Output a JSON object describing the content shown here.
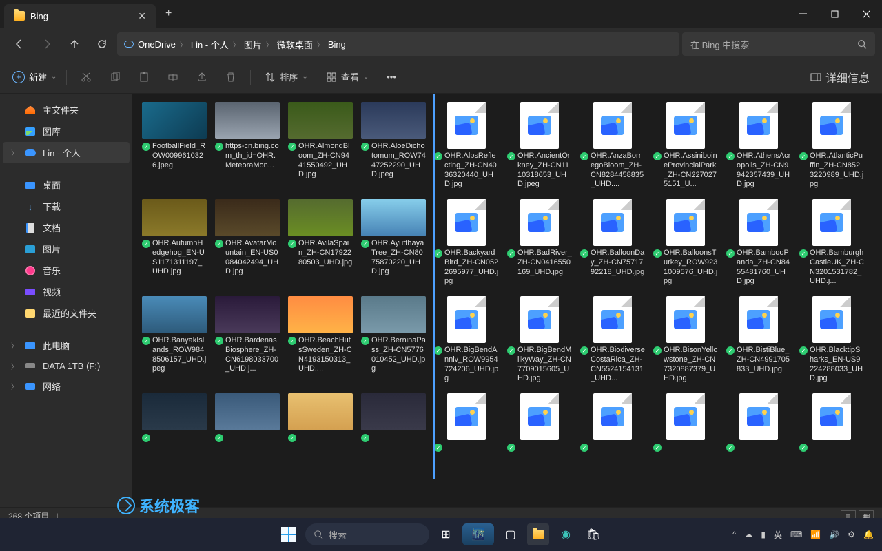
{
  "tab": {
    "title": "Bing"
  },
  "breadcrumbs": [
    "OneDrive",
    "Lin - 个人",
    "图片",
    "微软桌面",
    "Bing"
  ],
  "search": {
    "placeholder": "在 Bing 中搜索"
  },
  "toolbar": {
    "new": "新建",
    "sort": "排序",
    "view": "查看",
    "details": "详细信息"
  },
  "sidebar": {
    "home": "主文件夹",
    "gallery": "图库",
    "onedrive": "Lin - 个人",
    "desktop": "桌面",
    "downloads": "下载",
    "documents": "文档",
    "pictures": "图片",
    "music": "音乐",
    "videos": "视频",
    "recent": "最近的文件夹",
    "thispc": "此电脑",
    "drive": "DATA 1TB (F:)",
    "network": "网络"
  },
  "files": [
    {
      "name": "FootballField_ROW0099610326.jpeg",
      "t": "t0",
      "img": true
    },
    {
      "name": "https-cn.bing.com_th_id=OHR.MeteoraMon...",
      "t": "t1",
      "img": true
    },
    {
      "name": "OHR.AlmondBloom_ZH-CN9441550492_UHD.jpg",
      "t": "t2",
      "img": true
    },
    {
      "name": "OHR.AloeDichotomum_ROW7447252290_UHD.jpeg",
      "t": "t3",
      "img": true
    },
    {
      "name": "OHR.AlpsReflecting_ZH-CN4036320440_UHD.jpg",
      "t": "",
      "img": false
    },
    {
      "name": "OHR.AncientOrkney_ZH-CN1110318653_UHD.jpeg",
      "t": "",
      "img": false
    },
    {
      "name": "OHR.AnzaBorregoBloom_ZH-CN8284458835_UHD....",
      "t": "",
      "img": false
    },
    {
      "name": "OHR.AssiniboineProvincialPark_ZH-CN2270275151_U...",
      "t": "",
      "img": false
    },
    {
      "name": "OHR.AthensAcropolis_ZH-CN9942357439_UHD.jpg",
      "t": "",
      "img": false
    },
    {
      "name": "OHR.AtlanticPuffin_ZH-CN8523220989_UHD.jpg",
      "t": "",
      "img": false
    },
    {
      "name": "OHR.AutumnHedgehog_EN-US1171311197_UHD.jpg",
      "t": "t4",
      "img": true
    },
    {
      "name": "OHR.AvatarMountain_EN-US0084042494_UHD.jpg",
      "t": "t5",
      "img": true
    },
    {
      "name": "OHR.AvilaSpain_ZH-CN1792280503_UHD.jpg",
      "t": "t6",
      "img": true
    },
    {
      "name": "OHR.AyutthayaTree_ZH-CN8075870220_UHD.jpg",
      "t": "t7",
      "img": true
    },
    {
      "name": "OHR.BackyardBird_ZH-CN0522695977_UHD.jpg",
      "t": "",
      "img": false
    },
    {
      "name": "OHR.BadRiver_ZH-CN0416550169_UHD.jpg",
      "t": "",
      "img": false
    },
    {
      "name": "OHR.BalloonDay_ZH-CN7571792218_UHD.jpg",
      "t": "",
      "img": false
    },
    {
      "name": "OHR.BalloonsTurkey_ROW9231009576_UHD.jpg",
      "t": "",
      "img": false
    },
    {
      "name": "OHR.BambooPanda_ZH-CN8455481760_UHD.jpg",
      "t": "",
      "img": false
    },
    {
      "name": "OHR.BamburghCastleUK_ZH-CN3201531782_UHD.j...",
      "t": "",
      "img": false
    },
    {
      "name": "OHR.BanyakIslands_ROW9848506157_UHD.jpeg",
      "t": "t8",
      "img": true
    },
    {
      "name": "OHR.BardenasBiosphere_ZH-CN6198033700_UHD.j...",
      "t": "t9",
      "img": true
    },
    {
      "name": "OHR.BeachHutsSweden_ZH-CN4193150313_UHD....",
      "t": "t10",
      "img": true
    },
    {
      "name": "OHR.BerninaPass_ZH-CN5776010452_UHD.jpg",
      "t": "t11",
      "img": true
    },
    {
      "name": "OHR.BigBendAnniv_ROW9954724206_UHD.jpg",
      "t": "",
      "img": false
    },
    {
      "name": "OHR.BigBendMilkyWay_ZH-CN7709015605_UHD.jpg",
      "t": "",
      "img": false
    },
    {
      "name": "OHR.BiodiverseCostaRica_ZH-CN5524154131_UHD...",
      "t": "",
      "img": false
    },
    {
      "name": "OHR.BisonYellowstone_ZH-CN7320887379_UHD.jpg",
      "t": "",
      "img": false
    },
    {
      "name": "OHR.BistiBlue_ZH-CN4991705833_UHD.jpg",
      "t": "",
      "img": false
    },
    {
      "name": "OHR.BlacktipSharks_EN-US9224288033_UHD.jpg",
      "t": "",
      "img": false
    },
    {
      "name": "",
      "t": "t12",
      "img": true
    },
    {
      "name": "",
      "t": "t13",
      "img": true
    },
    {
      "name": "",
      "t": "t14",
      "img": true
    },
    {
      "name": "",
      "t": "t15",
      "img": true
    },
    {
      "name": "",
      "t": "",
      "img": false
    },
    {
      "name": "",
      "t": "",
      "img": false
    },
    {
      "name": "",
      "t": "",
      "img": false
    },
    {
      "name": "",
      "t": "",
      "img": false
    },
    {
      "name": "",
      "t": "",
      "img": false
    },
    {
      "name": "",
      "t": "",
      "img": false
    }
  ],
  "status": {
    "count": "268 个项目"
  },
  "taskbar": {
    "search": "搜索",
    "ime": "英"
  },
  "watermark": "系统极客"
}
